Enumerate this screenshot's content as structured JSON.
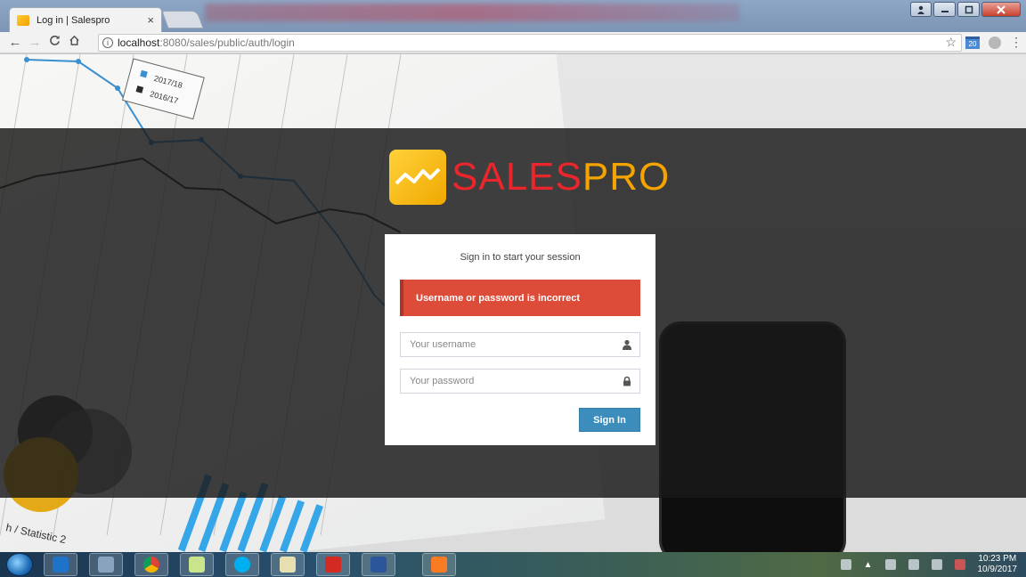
{
  "browser": {
    "tab_title": "Log in | Salespro",
    "tab_close": "×",
    "url_host": "localhost",
    "url_path": ":8080/sales/public/auth/login",
    "ext_calendar_label": "20",
    "icons": [
      "back-icon",
      "forward-icon",
      "reload-icon",
      "home-icon",
      "info-icon",
      "star-icon",
      "menu-icon"
    ]
  },
  "logo": {
    "text_part1": "SALES",
    "text_part2": "PRO",
    "colors": {
      "part1": "#e8262c",
      "part2": "#f4a300"
    }
  },
  "login": {
    "subtitle": "Sign in to start your session",
    "error": "Username or password is incorrect",
    "username_placeholder": "Your username",
    "password_placeholder": "Your password",
    "signin_label": "Sign In",
    "colors": {
      "error": "#dd4b39",
      "button": "#3c8dbc"
    }
  },
  "background_chart": {
    "legend": [
      "2017/18",
      "2016/17"
    ],
    "footer_label": "h / Statistic 2"
  },
  "taskbar": {
    "apps": [
      "outlook-app",
      "calculator-app",
      "chrome-app",
      "sticky-notes-app",
      "skype-app",
      "notepad-app",
      "acrobat-app",
      "word-app",
      "xampp-app"
    ],
    "time": "10:23 PM",
    "date": "10/9/2017"
  }
}
